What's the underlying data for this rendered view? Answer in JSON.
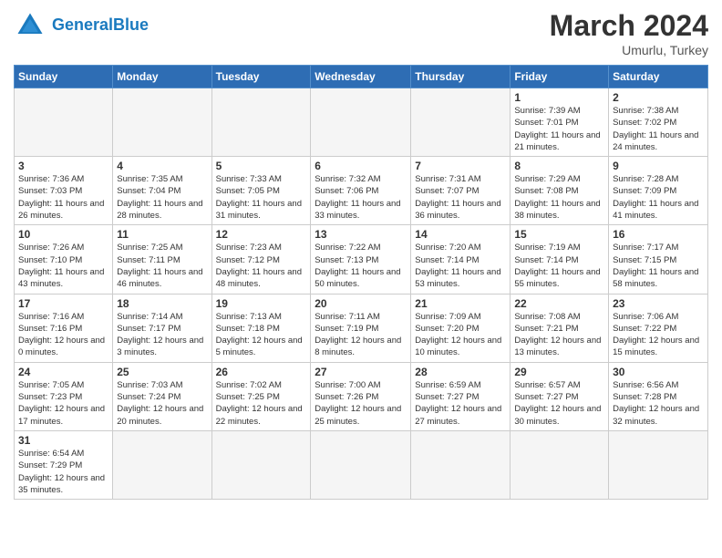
{
  "header": {
    "logo_general": "General",
    "logo_blue": "Blue",
    "month_title": "March 2024",
    "location": "Umurlu, Turkey"
  },
  "weekdays": [
    "Sunday",
    "Monday",
    "Tuesday",
    "Wednesday",
    "Thursday",
    "Friday",
    "Saturday"
  ],
  "weeks": [
    [
      {
        "day": "",
        "info": ""
      },
      {
        "day": "",
        "info": ""
      },
      {
        "day": "",
        "info": ""
      },
      {
        "day": "",
        "info": ""
      },
      {
        "day": "",
        "info": ""
      },
      {
        "day": "1",
        "info": "Sunrise: 7:39 AM\nSunset: 7:01 PM\nDaylight: 11 hours and 21 minutes."
      },
      {
        "day": "2",
        "info": "Sunrise: 7:38 AM\nSunset: 7:02 PM\nDaylight: 11 hours and 24 minutes."
      }
    ],
    [
      {
        "day": "3",
        "info": "Sunrise: 7:36 AM\nSunset: 7:03 PM\nDaylight: 11 hours and 26 minutes."
      },
      {
        "day": "4",
        "info": "Sunrise: 7:35 AM\nSunset: 7:04 PM\nDaylight: 11 hours and 28 minutes."
      },
      {
        "day": "5",
        "info": "Sunrise: 7:33 AM\nSunset: 7:05 PM\nDaylight: 11 hours and 31 minutes."
      },
      {
        "day": "6",
        "info": "Sunrise: 7:32 AM\nSunset: 7:06 PM\nDaylight: 11 hours and 33 minutes."
      },
      {
        "day": "7",
        "info": "Sunrise: 7:31 AM\nSunset: 7:07 PM\nDaylight: 11 hours and 36 minutes."
      },
      {
        "day": "8",
        "info": "Sunrise: 7:29 AM\nSunset: 7:08 PM\nDaylight: 11 hours and 38 minutes."
      },
      {
        "day": "9",
        "info": "Sunrise: 7:28 AM\nSunset: 7:09 PM\nDaylight: 11 hours and 41 minutes."
      }
    ],
    [
      {
        "day": "10",
        "info": "Sunrise: 7:26 AM\nSunset: 7:10 PM\nDaylight: 11 hours and 43 minutes."
      },
      {
        "day": "11",
        "info": "Sunrise: 7:25 AM\nSunset: 7:11 PM\nDaylight: 11 hours and 46 minutes."
      },
      {
        "day": "12",
        "info": "Sunrise: 7:23 AM\nSunset: 7:12 PM\nDaylight: 11 hours and 48 minutes."
      },
      {
        "day": "13",
        "info": "Sunrise: 7:22 AM\nSunset: 7:13 PM\nDaylight: 11 hours and 50 minutes."
      },
      {
        "day": "14",
        "info": "Sunrise: 7:20 AM\nSunset: 7:14 PM\nDaylight: 11 hours and 53 minutes."
      },
      {
        "day": "15",
        "info": "Sunrise: 7:19 AM\nSunset: 7:14 PM\nDaylight: 11 hours and 55 minutes."
      },
      {
        "day": "16",
        "info": "Sunrise: 7:17 AM\nSunset: 7:15 PM\nDaylight: 11 hours and 58 minutes."
      }
    ],
    [
      {
        "day": "17",
        "info": "Sunrise: 7:16 AM\nSunset: 7:16 PM\nDaylight: 12 hours and 0 minutes."
      },
      {
        "day": "18",
        "info": "Sunrise: 7:14 AM\nSunset: 7:17 PM\nDaylight: 12 hours and 3 minutes."
      },
      {
        "day": "19",
        "info": "Sunrise: 7:13 AM\nSunset: 7:18 PM\nDaylight: 12 hours and 5 minutes."
      },
      {
        "day": "20",
        "info": "Sunrise: 7:11 AM\nSunset: 7:19 PM\nDaylight: 12 hours and 8 minutes."
      },
      {
        "day": "21",
        "info": "Sunrise: 7:09 AM\nSunset: 7:20 PM\nDaylight: 12 hours and 10 minutes."
      },
      {
        "day": "22",
        "info": "Sunrise: 7:08 AM\nSunset: 7:21 PM\nDaylight: 12 hours and 13 minutes."
      },
      {
        "day": "23",
        "info": "Sunrise: 7:06 AM\nSunset: 7:22 PM\nDaylight: 12 hours and 15 minutes."
      }
    ],
    [
      {
        "day": "24",
        "info": "Sunrise: 7:05 AM\nSunset: 7:23 PM\nDaylight: 12 hours and 17 minutes."
      },
      {
        "day": "25",
        "info": "Sunrise: 7:03 AM\nSunset: 7:24 PM\nDaylight: 12 hours and 20 minutes."
      },
      {
        "day": "26",
        "info": "Sunrise: 7:02 AM\nSunset: 7:25 PM\nDaylight: 12 hours and 22 minutes."
      },
      {
        "day": "27",
        "info": "Sunrise: 7:00 AM\nSunset: 7:26 PM\nDaylight: 12 hours and 25 minutes."
      },
      {
        "day": "28",
        "info": "Sunrise: 6:59 AM\nSunset: 7:27 PM\nDaylight: 12 hours and 27 minutes."
      },
      {
        "day": "29",
        "info": "Sunrise: 6:57 AM\nSunset: 7:27 PM\nDaylight: 12 hours and 30 minutes."
      },
      {
        "day": "30",
        "info": "Sunrise: 6:56 AM\nSunset: 7:28 PM\nDaylight: 12 hours and 32 minutes."
      }
    ],
    [
      {
        "day": "31",
        "info": "Sunrise: 6:54 AM\nSunset: 7:29 PM\nDaylight: 12 hours and 35 minutes."
      },
      {
        "day": "",
        "info": ""
      },
      {
        "day": "",
        "info": ""
      },
      {
        "day": "",
        "info": ""
      },
      {
        "day": "",
        "info": ""
      },
      {
        "day": "",
        "info": ""
      },
      {
        "day": "",
        "info": ""
      }
    ]
  ]
}
